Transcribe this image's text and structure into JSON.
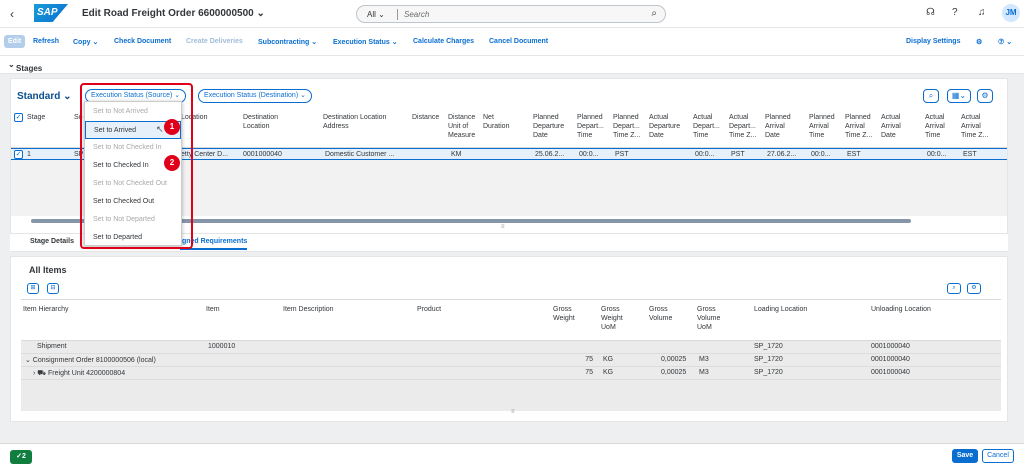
{
  "shell": {
    "back_icon": "chevron-left-icon",
    "logo_text": "SAP",
    "title": "Edit Road Freight Order 6600000500",
    "title_chevron": "⌄",
    "search_scope": "All",
    "search_placeholder": "Search",
    "avatar_initials": "JM"
  },
  "toolbar": {
    "edit": "Edit",
    "refresh": "Refresh",
    "copy": "Copy ⌄",
    "check_document": "Check Document",
    "create_deliveries": "Create Deliveries",
    "subcontracting": "Subcontracting ⌄",
    "execution_status": "Execution Status ⌄",
    "calculate_charges": "Calculate Charges",
    "cancel_document": "Cancel Document",
    "display_settings": "Display Settings"
  },
  "stages": {
    "section_title": "Stages",
    "variant": "Standard",
    "exec_source_button": "Execution Status (Source) ⌄",
    "exec_dest_button": "Execution Status (Destination) ⌄",
    "columns": [
      "Stage",
      "So",
      "Location",
      "Destination Location",
      "Destination Location Address",
      "Distance",
      "Distance Unit of Measure",
      "Net Duration",
      "Planned Departure Date",
      "Planned Depart... Time",
      "Planned Depart... Time Z...",
      "Actual Departure Date",
      "Actual Depart... Time",
      "Actual Depart... Time Z...",
      "Planned Arrival Date",
      "Planned Arrival Time",
      "Planned Arrival Time Z...",
      "Actual Arrival Date",
      "Actual Arrival Time",
      "Actual Arrival Time Z..."
    ],
    "row": {
      "stage": "1",
      "so": "SP",
      "location": "etty Center D...",
      "dest_location": "0001000040",
      "dest_address": "Domestic Customer ...",
      "distance_uom": "KM",
      "planned_dep_date": "25.06.2...",
      "planned_dep_time": "00:0...",
      "planned_dep_tz": "PST",
      "actual_dep_time": "00:0...",
      "actual_dep_tz": "PST",
      "planned_arr_date": "27.06.2...",
      "planned_arr_time": "00:0...",
      "planned_arr_tz": "EST",
      "actual_arr_time": "00:0...",
      "actual_arr_tz": "EST"
    }
  },
  "dropdown": {
    "items": [
      "Set to Not Arrived",
      "Set to Arrived",
      "Set to Not Checked In",
      "Set to Checked In",
      "Set to Not Checked Out",
      "Set to Checked Out",
      "Set to Not Departed",
      "Set to Departed"
    ],
    "badge1": "1",
    "badge2": "2"
  },
  "tabs": {
    "stage_details": "Stage Details",
    "assigned": "igned Requirements"
  },
  "items": {
    "title": "All Items",
    "columns": [
      "Item Hierarchy",
      "Item",
      "Item Description",
      "Product",
      "Gross Weight",
      "Gross Weight UoM",
      "Gross Volume",
      "Gross Volume UoM",
      "Loading Location",
      "Unloading Location"
    ],
    "rows": [
      {
        "hierarchy": "Shipment",
        "item": "1000010",
        "weight": "",
        "weight_uom": "",
        "volume": "",
        "volume_uom": "",
        "loading": "SP_1720",
        "unloading": "0001000040"
      },
      {
        "hierarchy": "⌄  Consignment Order 8100000506 (local)",
        "item": "",
        "weight": "75",
        "weight_uom": "KG",
        "volume": "0,00025",
        "volume_uom": "M3",
        "loading": "SP_1720",
        "unloading": "0001000040"
      },
      {
        "hierarchy": "›  ⛟ Freight Unit 4200000804",
        "item": "",
        "weight": "75",
        "weight_uom": "KG",
        "volume": "0,00025",
        "volume_uom": "M3",
        "loading": "SP_1720",
        "unloading": "0001000040"
      }
    ]
  },
  "footer": {
    "messages": "2",
    "save": "Save",
    "cancel": "Cancel"
  },
  "colors": {
    "brand": "#0a6ed1",
    "highlight": "#e0001a",
    "success": "#107e3e"
  }
}
